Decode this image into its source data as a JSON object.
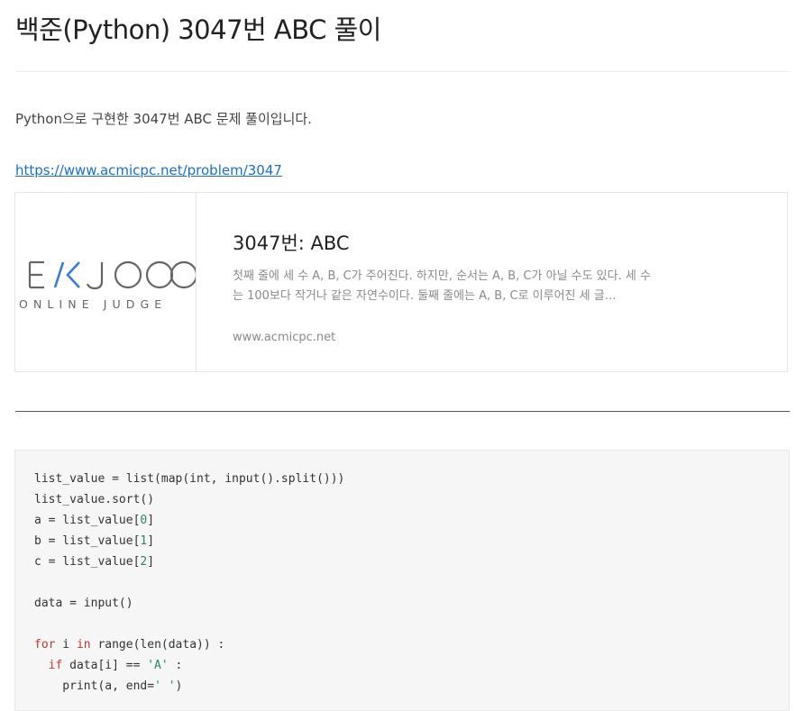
{
  "post": {
    "title": "백준(Python) 3047번 ABC 풀이",
    "intro": "Python으로 구현한 3047번 ABC 문제 풀이입니다.",
    "link_text": "https://www.acmicpc.net/problem/3047"
  },
  "link_card": {
    "logo_main": "E/KJOO",
    "logo_sub": "ONLINE JUDGE",
    "title": "3047번: ABC",
    "description": "첫째 줄에 세 수 A, B, C가 주어진다. 하지만, 순서는 A, B, C가 아닐 수도 있다. 세 수는 100보다 작거나 같은 자연수이다. 둘째 줄에는 A, B, C로 이루어진 세 글…",
    "domain": "www.acmicpc.net"
  },
  "code": {
    "lines": [
      "list_value = list(map(int, input().split()))",
      "list_value.sort()",
      "a = list_value[0]",
      "b = list_value[1]",
      "c = list_value[2]",
      "",
      "data = input()",
      "",
      "for i in range(len(data)) :",
      "  if data[i] == 'A' :",
      "    print(a, end=' ')"
    ],
    "colors": {
      "keyword": "#c0392b",
      "number": "#2a8a5a",
      "string": "#2a8a5a"
    }
  },
  "colors": {
    "link": "#1a6fc8",
    "code_background": "#f6f6f6",
    "logo_accent": "#3a7bd5"
  }
}
